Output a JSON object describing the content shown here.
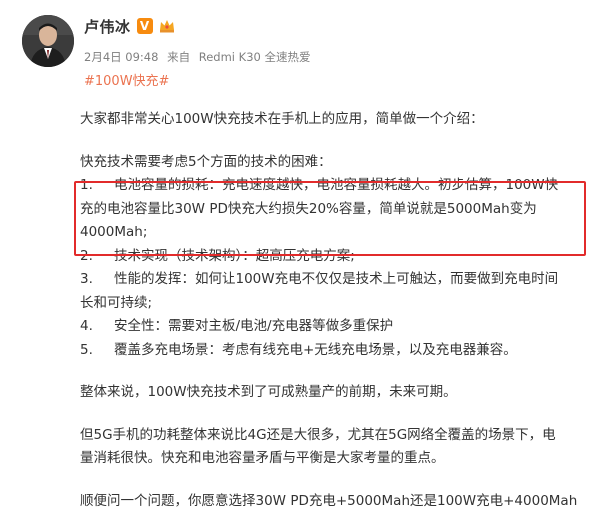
{
  "author": {
    "name": "卢伟冰",
    "verify_badge": "V"
  },
  "meta": {
    "date": "2月4日 09:48",
    "source_prefix": "来自",
    "device": "Redmi K30 全速热爱"
  },
  "hashtag": "#100W快充#",
  "content": {
    "intro": "大家都非常关心100W快充技术在手机上的应用，简单做一个介绍：",
    "challenges_heading": "快充技术需要考虑5个方面的技术的困难：",
    "item1_line1_num": "1.",
    "item1_line1": "电池容量的损耗：充电速度越快，电池容量损耗越大。初步估算，100W快",
    "item1_line2": "充的电池容量比30W PD快充大约损失20%容量，简单说就是5000Mah变为",
    "item1_line3": "4000Mah;",
    "item2_num": "2.",
    "item2": "技术实现（技术架构）：超高压充电方案;",
    "item3_num": "3.",
    "item3_line1": "性能的发挥：如何让100W充电不仅仅是技术上可触达，而要做到充电时间",
    "item3_line2": "长和可持续;",
    "item4_num": "4.",
    "item4": "安全性：需要对主板/电池/充电器等做多重保护",
    "item5_num": "5.",
    "item5": "覆盖多充电场景：考虑有线充电+无线充电场景，以及充电器兼容。",
    "summary": "整体来说，100W快充技术到了可成熟量产的前期，未来可期。",
    "para_5g_line1": "但5G手机的功耗整体来说比4G还是大很多，尤其在5G网络全覆盖的场景下，电",
    "para_5g_line2": "量消耗很快。快充和电池容量矛盾与平衡是大家考量的重点。",
    "question": "顺便问一个问题，你愿意选择30W PD充电+5000Mah还是100W充电+4000Mah"
  },
  "colors": {
    "hashtag": "#eb7350",
    "highlight_border": "#e22b2b",
    "verify_badge": "#f78b0f"
  }
}
